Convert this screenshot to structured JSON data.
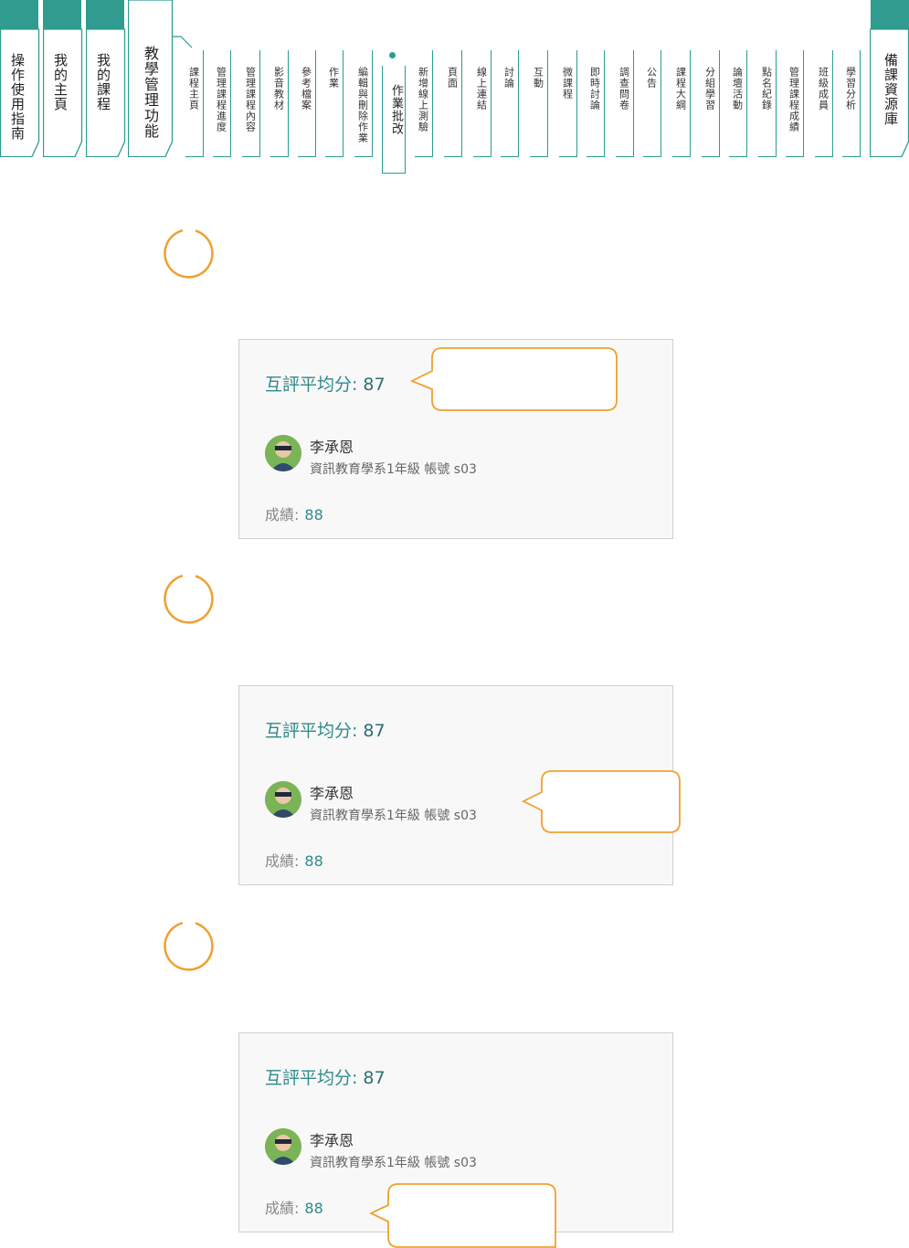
{
  "nav": {
    "main_tabs": [
      "操作使用指南",
      "我的主頁",
      "我的課程"
    ],
    "teaching_tab": "教學管理功能",
    "sub_tabs": [
      "課程主頁",
      "管理課程進度",
      "管理課程內容",
      "影音教材",
      "參考檔案",
      "作業",
      "編輯與刪除作業",
      "作業批改",
      "新增線上測驗",
      "頁面",
      "線上連結",
      "討論",
      "互動",
      "微課程",
      "即時討論",
      "調查問卷",
      "公告",
      "課程大綱",
      "分組學習",
      "論壇活動",
      "點名紀錄",
      "管理課程成績",
      "班級成員",
      "學習分析"
    ],
    "resource_tab": "備課資源庫"
  },
  "cards": [
    {
      "avg_label": "互評平均分:",
      "avg_value": "87",
      "name": "李承恩",
      "meta": "資訊教育學系1年級 帳號 s03",
      "score_label": "成績:",
      "score_value": "88"
    },
    {
      "avg_label": "互評平均分:",
      "avg_value": "87",
      "name": "李承恩",
      "meta": "資訊教育學系1年級 帳號 s03",
      "score_label": "成績:",
      "score_value": "88"
    },
    {
      "avg_label": "互評平均分:",
      "avg_value": "87",
      "name": "李承恩",
      "meta": "資訊教育學系1年級 帳號 s03",
      "score_label": "成績:",
      "score_value": "88"
    }
  ],
  "colors": {
    "accent": "#2a9d8f",
    "callout": "#f0a030",
    "score_text": "#2f8a8a"
  },
  "icons": {
    "avatar": "student-avatar-photo",
    "step": "orange-step-circle"
  }
}
